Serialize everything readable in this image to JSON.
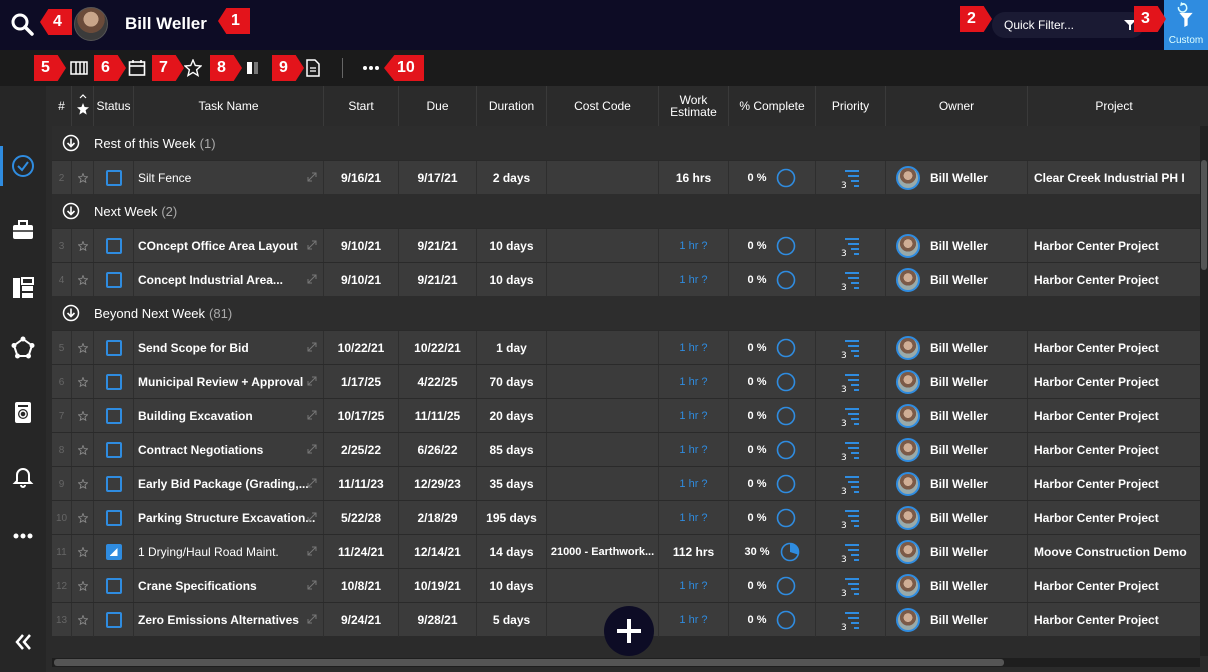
{
  "header": {
    "user_name": "Bill Weller",
    "quick_filter_placeholder": "Quick Filter...",
    "custom_label": "Custom"
  },
  "annotations": [
    "1",
    "2",
    "3",
    "4",
    "5",
    "6",
    "7",
    "8",
    "9",
    "10"
  ],
  "toolbar": {
    "icons": [
      "columns-icon",
      "calendar-icon",
      "star-icon",
      "split-view-icon",
      "document-icon",
      "more-icon"
    ]
  },
  "rail": {
    "items": [
      "tasks-check-icon",
      "briefcase-icon",
      "layout-icon",
      "network-icon",
      "timer-icon",
      "bell-icon",
      "more-icon",
      "collapse-icon"
    ]
  },
  "columns": {
    "num": "#",
    "status": "Status",
    "task": "Task Name",
    "start": "Start",
    "due": "Due",
    "duration": "Duration",
    "cost_code": "Cost Code",
    "work_estimate": "Work Estimate",
    "pct_complete": "% Complete",
    "priority": "Priority",
    "owner": "Owner",
    "project": "Project"
  },
  "groups": [
    {
      "name": "Rest of this Week",
      "count": "(1)",
      "rows": [
        {
          "num": "2",
          "task": "Silt Fence",
          "start": "9/16/21",
          "due": "9/17/21",
          "duration": "2 days",
          "cost_code": "",
          "work": "16 hrs",
          "work_link": false,
          "pct": "0 %",
          "progress": 0,
          "owner": "Bill Weller",
          "project": "Clear Creek Industrial PH I",
          "checked": false,
          "bold_task": false
        }
      ]
    },
    {
      "name": "Next Week",
      "count": "(2)",
      "rows": [
        {
          "num": "3",
          "task": "COncept Office Area Layout",
          "start": "9/10/21",
          "due": "9/21/21",
          "duration": "10 days",
          "cost_code": "",
          "work": "1 hr ?",
          "work_link": true,
          "pct": "0 %",
          "progress": 0,
          "owner": "Bill Weller",
          "project": "Harbor Center Project",
          "checked": false,
          "bold_task": true
        },
        {
          "num": "4",
          "task": "Concept Industrial Area...",
          "start": "9/10/21",
          "due": "9/21/21",
          "duration": "10 days",
          "cost_code": "",
          "work": "1 hr ?",
          "work_link": true,
          "pct": "0 %",
          "progress": 0,
          "owner": "Bill Weller",
          "project": "Harbor Center Project",
          "checked": false,
          "bold_task": true
        }
      ]
    },
    {
      "name": "Beyond Next Week",
      "count": "(81)",
      "rows": [
        {
          "num": "5",
          "task": "Send Scope for Bid",
          "start": "10/22/21",
          "due": "10/22/21",
          "duration": "1 day",
          "cost_code": "",
          "work": "1 hr ?",
          "work_link": true,
          "pct": "0 %",
          "progress": 0,
          "owner": "Bill Weller",
          "project": "Harbor Center Project",
          "checked": false,
          "bold_task": true
        },
        {
          "num": "6",
          "task": "Municipal Review + Approval",
          "start": "1/17/25",
          "due": "4/22/25",
          "duration": "70 days",
          "cost_code": "",
          "work": "1 hr ?",
          "work_link": true,
          "pct": "0 %",
          "progress": 0,
          "owner": "Bill Weller",
          "project": "Harbor Center Project",
          "checked": false,
          "bold_task": true
        },
        {
          "num": "7",
          "task": "Building Excavation",
          "start": "10/17/25",
          "due": "11/11/25",
          "duration": "20 days",
          "cost_code": "",
          "work": "1 hr ?",
          "work_link": true,
          "pct": "0 %",
          "progress": 0,
          "owner": "Bill Weller",
          "project": "Harbor Center Project",
          "checked": false,
          "bold_task": true
        },
        {
          "num": "8",
          "task": "Contract Negotiations",
          "start": "2/25/22",
          "due": "6/26/22",
          "duration": "85 days",
          "cost_code": "",
          "work": "1 hr ?",
          "work_link": true,
          "pct": "0 %",
          "progress": 0,
          "owner": "Bill Weller",
          "project": "Harbor Center Project",
          "checked": false,
          "bold_task": true
        },
        {
          "num": "9",
          "task": "Early Bid Package (Grading,...",
          "start": "11/11/23",
          "due": "12/29/23",
          "duration": "35 days",
          "cost_code": "",
          "work": "1 hr ?",
          "work_link": true,
          "pct": "0 %",
          "progress": 0,
          "owner": "Bill Weller",
          "project": "Harbor Center Project",
          "checked": false,
          "bold_task": true
        },
        {
          "num": "10",
          "task": "Parking Structure Excavation...",
          "start": "5/22/28",
          "due": "2/18/29",
          "duration": "195 days",
          "cost_code": "",
          "work": "1 hr ?",
          "work_link": true,
          "pct": "0 %",
          "progress": 0,
          "owner": "Bill Weller",
          "project": "Harbor Center Project",
          "checked": false,
          "bold_task": true
        },
        {
          "num": "11",
          "task": "1 Drying/Haul Road Maint.",
          "start": "11/24/21",
          "due": "12/14/21",
          "duration": "14 days",
          "cost_code": "21000 - Earthwork...",
          "work": "112 hrs",
          "work_link": false,
          "pct": "30 %",
          "progress": 30,
          "owner": "Bill Weller",
          "project": "Moove Construction Demo",
          "checked": true,
          "bold_task": false
        },
        {
          "num": "12",
          "task": "Crane Specifications",
          "start": "10/8/21",
          "due": "10/19/21",
          "duration": "10 days",
          "cost_code": "",
          "work": "1 hr ?",
          "work_link": true,
          "pct": "0 %",
          "progress": 0,
          "owner": "Bill Weller",
          "project": "Harbor Center Project",
          "checked": false,
          "bold_task": true
        },
        {
          "num": "13",
          "task": "Zero Emissions Alternatives",
          "start": "9/24/21",
          "due": "9/28/21",
          "duration": "5 days",
          "cost_code": "",
          "work": "1 hr ?",
          "work_link": true,
          "pct": "0 %",
          "progress": 0,
          "owner": "Bill Weller",
          "project": "Harbor Center Project",
          "checked": false,
          "bold_task": true
        }
      ]
    }
  ],
  "colors": {
    "accent": "#2f8ce0",
    "badge": "#e3141b",
    "topbar": "#0d0c25"
  }
}
